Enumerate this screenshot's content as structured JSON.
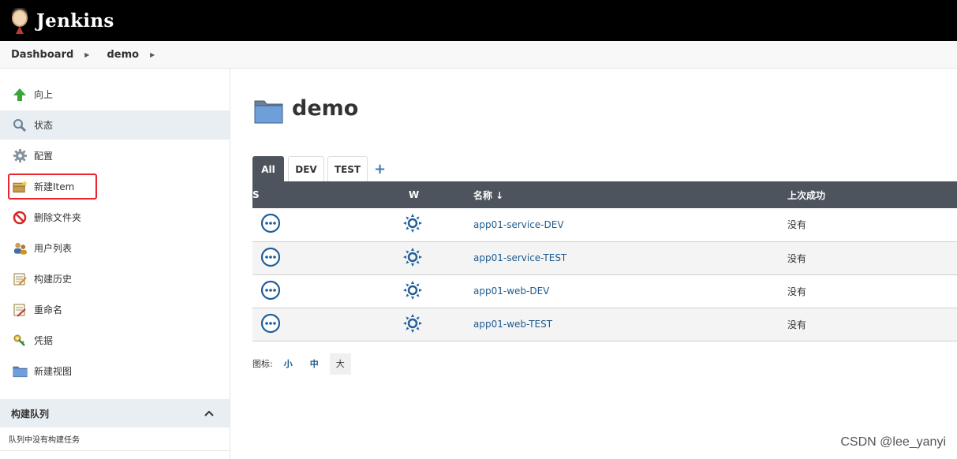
{
  "header": {
    "title": "Jenkins"
  },
  "breadcrumb": {
    "items": [
      "Dashboard",
      "demo"
    ]
  },
  "sidebar": {
    "items": [
      {
        "label": "向上",
        "icon": "up-arrow-icon"
      },
      {
        "label": "状态",
        "icon": "magnifier-icon"
      },
      {
        "label": "配置",
        "icon": "gear-icon"
      },
      {
        "label": "新建Item",
        "icon": "new-package-icon"
      },
      {
        "label": "删除文件夹",
        "icon": "no-entry-icon"
      },
      {
        "label": "用户列表",
        "icon": "users-icon"
      },
      {
        "label": "构建历史",
        "icon": "notepad-icon"
      },
      {
        "label": "重命名",
        "icon": "notepad-pencil-icon"
      },
      {
        "label": "凭据",
        "icon": "keys-icon"
      },
      {
        "label": "新建视图",
        "icon": "folder-icon"
      }
    ],
    "build_queue": {
      "title": "构建队列",
      "empty_text": "队列中没有构建任务"
    }
  },
  "main": {
    "title": "demo",
    "tabs": [
      "All",
      "DEV",
      "TEST"
    ],
    "add_tab": "+",
    "table": {
      "headers": {
        "s": "S",
        "w": "W",
        "name": "名称 ↓",
        "last_success": "上次成功"
      },
      "rows": [
        {
          "name": "app01-service-DEV",
          "last_success": "没有"
        },
        {
          "name": "app01-service-TEST",
          "last_success": "没有"
        },
        {
          "name": "app01-web-DEV",
          "last_success": "没有"
        },
        {
          "name": "app01-web-TEST",
          "last_success": "没有"
        }
      ]
    },
    "icon_size": {
      "label": "图标:",
      "options": [
        "小",
        "中",
        "大"
      ],
      "selected": "大"
    }
  },
  "watermark": "CSDN @lee_yanyi",
  "colors": {
    "header_bg": "#000000",
    "table_header_bg": "#4d545d",
    "link": "#1e5b8f",
    "highlight": "#e8262c",
    "status_icon": "#1f5e9c"
  }
}
